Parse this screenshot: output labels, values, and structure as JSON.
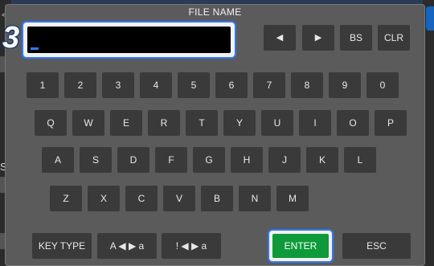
{
  "background": {
    "left_fragment": "SC",
    "top_left_glyph": "<"
  },
  "dialog": {
    "title": "FILE NAME",
    "step_number": "3",
    "input": {
      "value": ""
    },
    "nav": {
      "left": "◀",
      "right": "▶",
      "bs": "BS",
      "clr": "CLR"
    },
    "rows": {
      "digits": [
        "1",
        "2",
        "3",
        "4",
        "5",
        "6",
        "7",
        "8",
        "9",
        "0"
      ],
      "row1": [
        "Q",
        "W",
        "E",
        "R",
        "T",
        "Y",
        "U",
        "I",
        "O",
        "P"
      ],
      "row2": [
        "A",
        "S",
        "D",
        "F",
        "G",
        "H",
        "J",
        "K",
        "L"
      ],
      "row3": [
        "Z",
        "X",
        "C",
        "V",
        "B",
        "N",
        "M"
      ]
    },
    "actions": {
      "key_type": "KEY TYPE",
      "alpha_case": "A ◀ ▶ a",
      "symbol_case": "! ◀ ▶ a",
      "enter": "ENTER",
      "esc": "ESC"
    },
    "colors": {
      "accent": "#2e78ff",
      "enter": "#0e9a3a",
      "dialog_bg": "#5b5b5b",
      "key_bg": "#3a3a3a"
    }
  }
}
